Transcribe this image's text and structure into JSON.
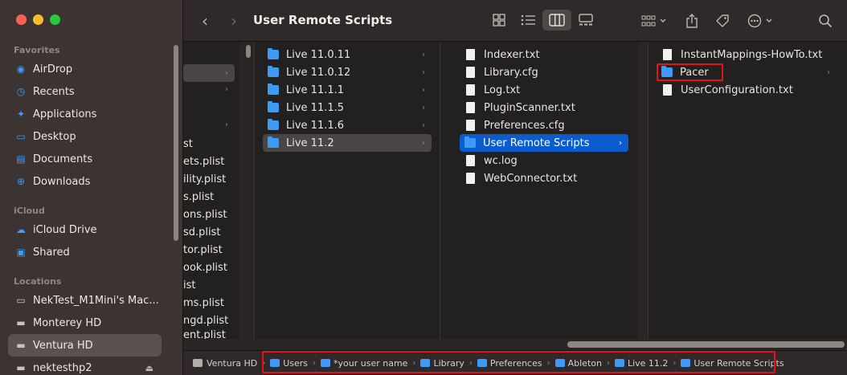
{
  "window": {
    "title": "User Remote Scripts"
  },
  "sidebar": {
    "favorites_header": "Favorites",
    "favorites": [
      {
        "label": "AirDrop",
        "icon": "airdrop-icon"
      },
      {
        "label": "Recents",
        "icon": "clock-icon"
      },
      {
        "label": "Applications",
        "icon": "applications-icon"
      },
      {
        "label": "Desktop",
        "icon": "desktop-icon"
      },
      {
        "label": "Documents",
        "icon": "document-icon"
      },
      {
        "label": "Downloads",
        "icon": "download-icon"
      }
    ],
    "icloud_header": "iCloud",
    "icloud": [
      {
        "label": "iCloud Drive",
        "icon": "cloud-icon"
      },
      {
        "label": "Shared",
        "icon": "shared-folder-icon"
      }
    ],
    "locations_header": "Locations",
    "locations": [
      {
        "label": "NekTest_M1Mini's Mac...",
        "icon": "computer-icon"
      },
      {
        "label": "Monterey HD",
        "icon": "drive-icon"
      },
      {
        "label": "Ventura HD",
        "icon": "drive-icon"
      },
      {
        "label": "nektesthp2",
        "icon": "drive-icon"
      }
    ]
  },
  "columns": {
    "col0": {
      "rows": [
        "st",
        "ets.plist",
        "ility.plist",
        "s.plist",
        "ons.plist",
        "sd.plist",
        "tor.plist",
        "ook.plist",
        "ist",
        "ms.plist",
        "ngd.plist",
        "ent.plist"
      ]
    },
    "col1": {
      "rows": [
        "Live 11.0.11",
        "Live 11.0.12",
        "Live 11.1.1",
        "Live 11.1.5",
        "Live 11.1.6",
        "Live 11.2"
      ]
    },
    "col2": {
      "rows": [
        "Indexer.txt",
        "Library.cfg",
        "Log.txt",
        "PluginScanner.txt",
        "Preferences.cfg",
        "User Remote Scripts",
        "wc.log",
        "WebConnector.txt"
      ]
    },
    "col3": {
      "rows": [
        "InstantMappings-HowTo.txt",
        "Pacer",
        "UserConfiguration.txt"
      ]
    }
  },
  "pathbar": {
    "items": [
      "Ventura HD",
      "Users",
      "*your user name",
      "Library",
      "Preferences",
      "Ableton",
      "Live 11.2",
      "User Remote Scripts"
    ]
  },
  "colors": {
    "selection": "#0b5dcf",
    "folder": "#3d9bf6",
    "highlight_box": "#e3121b"
  }
}
